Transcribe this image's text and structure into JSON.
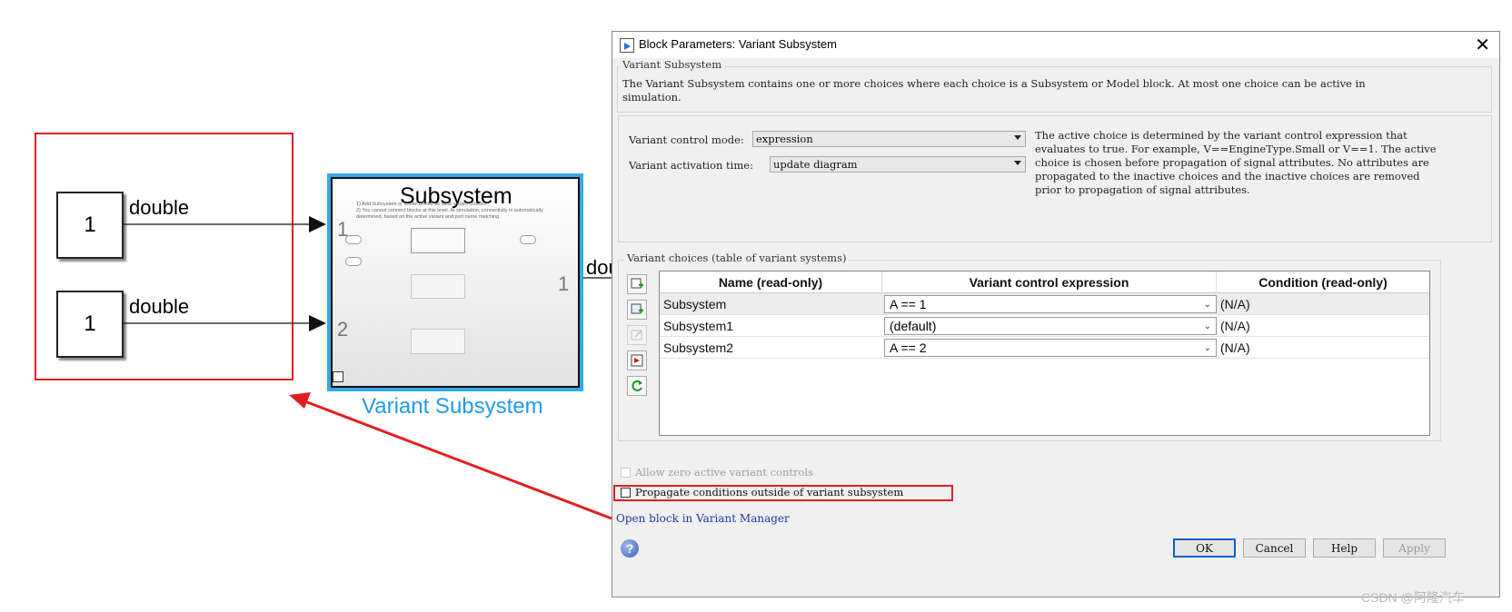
{
  "canvas": {
    "constant_top": "1",
    "constant_bottom": "1",
    "signal_top": "double",
    "signal_bottom": "double",
    "in_port_1": "1",
    "in_port_2": "2",
    "out_port_1": "1",
    "out_signal_partial": "dou",
    "subsystem_title": "Subsystem",
    "subsystem_note_line1": "1) Add Subsystem or Model blocks as valid variant choices.",
    "subsystem_note_line2": "2) You cannot connect blocks at this level. At simulation, connectivity is automatically",
    "subsystem_note_line3": "determined, based on the active variant and port name matching.",
    "subsystem_name": "Variant Subsystem",
    "highlight_color": "#e02020",
    "subsystem_border_color": "#38a8e8"
  },
  "dialog": {
    "title": "Block Parameters: Variant Subsystem",
    "close_glyph": "✕",
    "group_label": "Variant Subsystem",
    "description": "The Variant Subsystem contains one or more choices where each choice is a Subsystem or Model block. At most one choice can be active in simulation.",
    "control_mode_label": "Variant control mode:",
    "control_mode_value": "expression",
    "activation_time_label": "Variant activation time:",
    "activation_time_value": "update diagram",
    "help_text": "The active choice is determined by the variant control expression that evaluates to true. For example, V==EngineType.Small or V==1. The active choice is chosen before propagation of signal attributes. No attributes are propagated to the inactive choices and the inactive choices are removed prior to propagation of signal attributes.",
    "choices_label": "Variant choices (table of variant systems)",
    "table": {
      "headers": [
        "Name (read-only)",
        "Variant control expression",
        "Condition (read-only)"
      ],
      "rows": [
        {
          "name": "Subsystem",
          "expression": "A == 1",
          "condition": "(N/A)"
        },
        {
          "name": "Subsystem1",
          "expression": "(default)",
          "condition": "(N/A)"
        },
        {
          "name": "Subsystem2",
          "expression": "A == 2",
          "condition": "(N/A)"
        }
      ]
    },
    "allow_zero_label": "Allow zero active variant controls",
    "propagate_label": "Propagate conditions outside of variant subsystem",
    "open_manager_link": "Open block in Variant Manager",
    "buttons": {
      "ok": "OK",
      "cancel": "Cancel",
      "help": "Help",
      "apply": "Apply"
    }
  },
  "watermark": "CSDN @阿隆汽车"
}
